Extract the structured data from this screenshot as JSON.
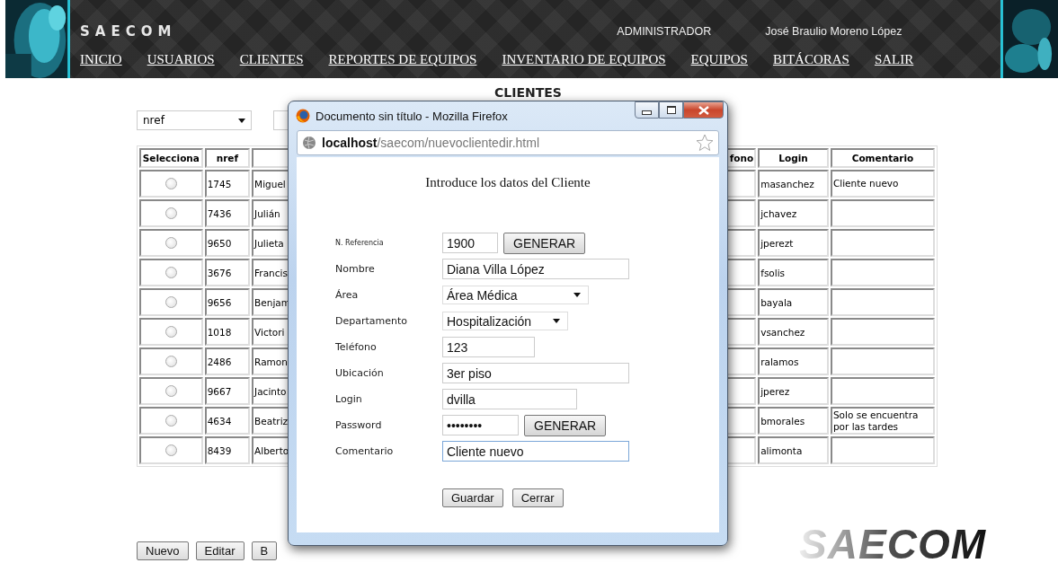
{
  "header": {
    "brand": "SAECOM",
    "role": "ADMINISTRADOR",
    "user": "José Braulio Moreno López",
    "nav": [
      "INICIO",
      "USUARIOS",
      "CLIENTES",
      "REPORTES DE EQUIPOS",
      "INVENTARIO DE EQUIPOS",
      "EQUIPOS",
      "BITÁCORAS",
      "SALIR"
    ]
  },
  "page": {
    "title": "CLIENTES",
    "sort_select": "nref",
    "table": {
      "columns": [
        "Selecciona",
        "nref",
        "fono",
        "Login",
        "Comentario"
      ],
      "rows": [
        {
          "selected": false,
          "nref": "1745",
          "name": "Miguel",
          "login": "masanchez",
          "comment": "Cliente nuevo"
        },
        {
          "selected": false,
          "nref": "7436",
          "name": "Julián",
          "login": "jchavez"
        },
        {
          "selected": false,
          "nref": "9650",
          "name": "Julieta",
          "login": "jperezt"
        },
        {
          "selected": false,
          "nref": "3676",
          "name": "Francis",
          "login": "fsolis"
        },
        {
          "selected": false,
          "nref": "9656",
          "name": "Benjam",
          "login": "bayala"
        },
        {
          "selected": false,
          "nref": "1018",
          "name": "Victori",
          "login": "vsanchez"
        },
        {
          "selected": false,
          "nref": "2486",
          "name": "Ramon",
          "login": "ralamos"
        },
        {
          "selected": false,
          "nref": "9667",
          "name": "Jacinto",
          "login": "jperez"
        },
        {
          "selected": false,
          "nref": "4634",
          "name": "Beatriz",
          "login": "bmorales",
          "comment": "Solo se encuentra por las tardes"
        },
        {
          "selected": false,
          "nref": "8439",
          "name": "Alberto",
          "login": "alimonta"
        }
      ]
    },
    "buttons": [
      "Nuevo",
      "Editar",
      "B"
    ],
    "logo": "SAECOM"
  },
  "popup": {
    "title": "Documento sin título - Mozilla Firefox",
    "url_host": "localhost",
    "url_path": "/saecom/nuevoclientedir.html",
    "heading": "Introduce los datos del Cliente",
    "fields": [
      {
        "kind": "text",
        "label": "N. Referencia",
        "value": "1900",
        "button": "GENERAR",
        "focused": false
      },
      {
        "kind": "text",
        "label": "Nombre",
        "value": "Diana Villa López",
        "focused": false
      },
      {
        "kind": "select",
        "label": "Área",
        "value": "Área Médica",
        "focused": false
      },
      {
        "kind": "select",
        "label": "Departamento",
        "value": "Hospitalización",
        "focused": false
      },
      {
        "kind": "text",
        "label": "Teléfono",
        "value": "123",
        "focused": false
      },
      {
        "kind": "text",
        "label": "Ubicación",
        "value": "3er piso",
        "focused": false
      },
      {
        "kind": "text",
        "label": "Login",
        "value": "dvilla",
        "focused": false
      },
      {
        "kind": "text",
        "label": "Password",
        "value": "••••••••",
        "button": "GENERAR",
        "focused": false
      },
      {
        "kind": "text",
        "label": "Comentario",
        "value": "Cliente nuevo",
        "focused": true
      }
    ],
    "buttons": [
      "Guardar",
      "Cerrar"
    ]
  }
}
